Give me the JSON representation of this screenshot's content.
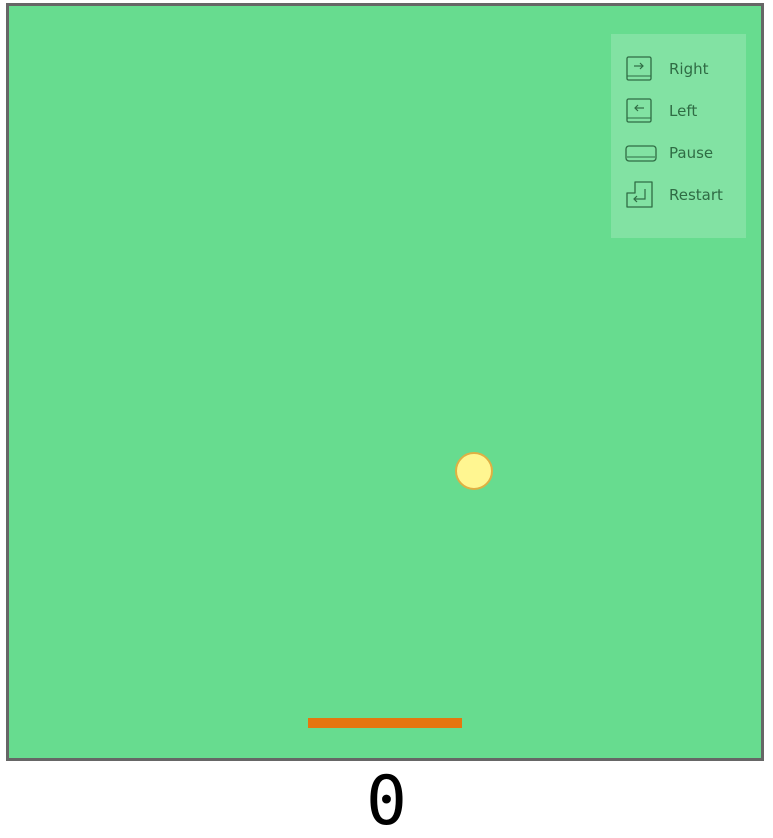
{
  "game": {
    "background_color": "#67dc8f",
    "border_color": "#666666",
    "ball_color": "#fff691",
    "ball_outline_color": "#dfb043",
    "paddle_color": "#e5760f"
  },
  "controls": [
    {
      "icon": "arrow-right-key-icon",
      "label": "Right"
    },
    {
      "icon": "arrow-left-key-icon",
      "label": "Left"
    },
    {
      "icon": "spacebar-key-icon",
      "label": "Pause"
    },
    {
      "icon": "enter-key-icon",
      "label": "Restart"
    }
  ],
  "score": "0"
}
